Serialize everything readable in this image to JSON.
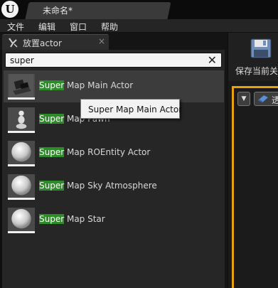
{
  "titlebar": {
    "logo": "unreal-engine-logo",
    "document_tab": "未命名*"
  },
  "menubar": {
    "items": [
      "文件",
      "编辑",
      "窗口",
      "帮助"
    ]
  },
  "panel": {
    "tab_label": "放置actor",
    "tab_icon": "place-actor-icon",
    "tab_close": "×",
    "search": {
      "value": "super",
      "clear_icon": "✕"
    },
    "items": [
      {
        "highlight": "Super",
        "rest": " Map Main Actor",
        "icon": "main-actor-icon",
        "selected": true
      },
      {
        "highlight": "Super",
        "rest": " Map Pawn",
        "icon": "pawn-icon",
        "selected": false
      },
      {
        "highlight": "Super",
        "rest": " Map ROEntity Actor",
        "icon": "sphere-icon",
        "selected": false
      },
      {
        "highlight": "Super",
        "rest": " Map Sky Atmosphere",
        "icon": "sphere-icon",
        "selected": false
      },
      {
        "highlight": "Super",
        "rest": " Map Star",
        "icon": "sphere-icon",
        "selected": false
      }
    ],
    "tooltip": "Super Map Main Actor"
  },
  "toolbar": {
    "save_label": "保存当前关",
    "save_icon": "floppy-disk-icon"
  },
  "viewport": {
    "dropdown_icon": "▼",
    "view_mode_label": "透",
    "view_mode_icon": "perspective-icon"
  },
  "colors": {
    "highlight": "#2e8b2a",
    "viewport_border": "#e8a10c",
    "background": "#262626"
  }
}
